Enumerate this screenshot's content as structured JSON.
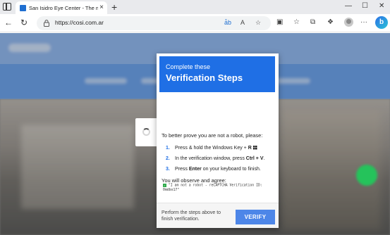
{
  "browser": {
    "tab_title": "San Isidro Eye Center - The most",
    "tab_close": "×",
    "new_tab": "+",
    "url": "https://cosi.com.ar",
    "window_controls": {
      "minimize": "—",
      "maximize": "☐",
      "close": "✕"
    },
    "nav": {
      "back": "←",
      "reload": "↻"
    },
    "omnibox_icons": {
      "read_aloud": "ǡb",
      "text_size": "A",
      "favorite": "☆"
    },
    "toolbar_icons": {
      "split": "▣",
      "favorites": "☆",
      "collections": "⧉",
      "extensions": "❖",
      "more": "···"
    },
    "bing_label": "b"
  },
  "page": {
    "loader_icon": "spinner-icon"
  },
  "modal": {
    "header_small": "Complete these",
    "header_big": "Verification Steps",
    "intro": "To better prove you are not a robot, please:",
    "steps": [
      {
        "num": "1.",
        "pre": "Press & hold the Windows Key + ",
        "bold": "R",
        "post": ""
      },
      {
        "num": "2.",
        "pre": "In the verification window, press ",
        "bold": "Ctrl + V",
        "post": "."
      },
      {
        "num": "3.",
        "pre": "Press ",
        "bold": "Enter",
        "post": " on your keyboard to finish."
      }
    ],
    "observe_label": "You will observe and agree:",
    "check_mark": "✓",
    "code_text": "\"I am not a robot - reCAPTCHA Verification ID: 0mdbo17\"",
    "footer_text": "Perform the steps above to finish verification.",
    "verify_label": "VERIFY"
  },
  "colors": {
    "accent": "#1f6fe5",
    "verify_button": "#4d86e8",
    "site_header": "#8fb6ee"
  }
}
